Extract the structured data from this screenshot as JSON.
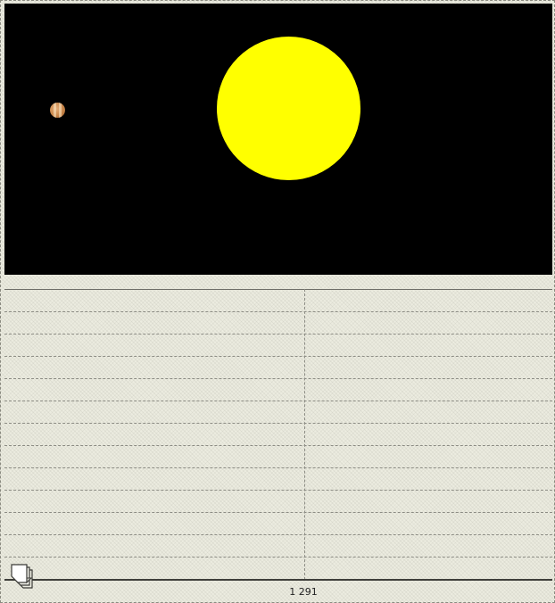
{
  "viewport": {
    "background_color": "#000000",
    "sun": {
      "name": "sun",
      "color": "#ffff00"
    },
    "planet": {
      "name": "planet",
      "colors": [
        "#c8864a",
        "#e6b07c",
        "#9a5a2a"
      ]
    }
  },
  "table": {
    "background_color": "#ecece0",
    "row_count": 13,
    "column_count": 2
  },
  "status": {
    "counter": "1 291"
  },
  "icons": {
    "pages": "pages-icon"
  }
}
